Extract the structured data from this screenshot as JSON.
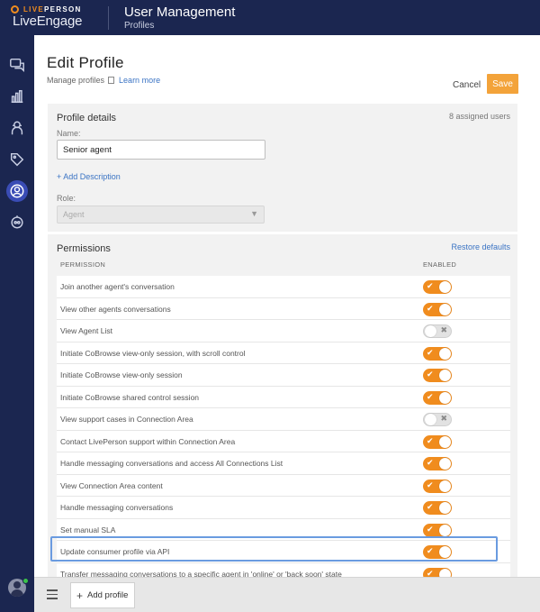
{
  "header": {
    "brand_small": "LIVEPERSON",
    "brand_small_accent": "LIVE",
    "brand_small_rest": "PERSON",
    "product": "LiveEngage",
    "title": "User Management",
    "subtitle": "Profiles"
  },
  "sidebar": {
    "items": [
      {
        "name": "conversations",
        "icon": "chat-bubbles-icon"
      },
      {
        "name": "reports",
        "icon": "bar-chart-icon"
      },
      {
        "name": "agents",
        "icon": "agent-icon"
      },
      {
        "name": "tags",
        "icon": "tag-icon"
      },
      {
        "name": "users",
        "icon": "user-circle-icon",
        "active": true
      },
      {
        "name": "bots",
        "icon": "bot-icon"
      }
    ]
  },
  "page": {
    "title": "Edit Profile",
    "subtitle": "Manage profiles",
    "learn_more": "Learn more",
    "cancel": "Cancel",
    "save": "Save"
  },
  "details": {
    "title": "Profile details",
    "assigned": "8 assigned users",
    "name_label": "Name:",
    "name_value": "Senior agent",
    "add_description": "+ Add Description",
    "role_label": "Role:",
    "role_value": "Agent"
  },
  "permissions": {
    "title": "Permissions",
    "restore": "Restore defaults",
    "col_permission": "PERMISSION",
    "col_enabled": "ENABLED",
    "rows": [
      {
        "label": "Join another agent's conversation",
        "enabled": true
      },
      {
        "label": "View other agents conversations",
        "enabled": true
      },
      {
        "label": "View Agent List",
        "enabled": false
      },
      {
        "label": "Initiate CoBrowse view-only session, with scroll control",
        "enabled": true
      },
      {
        "label": "Initiate CoBrowse view-only session",
        "enabled": true
      },
      {
        "label": "Initiate CoBrowse shared control session",
        "enabled": true
      },
      {
        "label": "View support cases in Connection Area",
        "enabled": false
      },
      {
        "label": "Contact LivePerson support within Connection Area",
        "enabled": true
      },
      {
        "label": "Handle messaging conversations and access All Connections List",
        "enabled": true
      },
      {
        "label": "View Connection Area content",
        "enabled": true
      },
      {
        "label": "Handle messaging conversations",
        "enabled": true
      },
      {
        "label": "Set manual SLA",
        "enabled": true
      },
      {
        "label": "Update consumer profile via API",
        "enabled": true
      },
      {
        "label": "Transfer messaging conversations to a specific agent in 'online' or 'back soon' state",
        "enabled": true
      }
    ]
  },
  "footer": {
    "add_profile": "Add profile"
  },
  "colors": {
    "navy": "#1b2650",
    "accent_orange": "#f08c1e",
    "save_orange": "#f3a33a",
    "link_blue": "#3b74c4",
    "highlight_blue": "#6a9be0"
  }
}
